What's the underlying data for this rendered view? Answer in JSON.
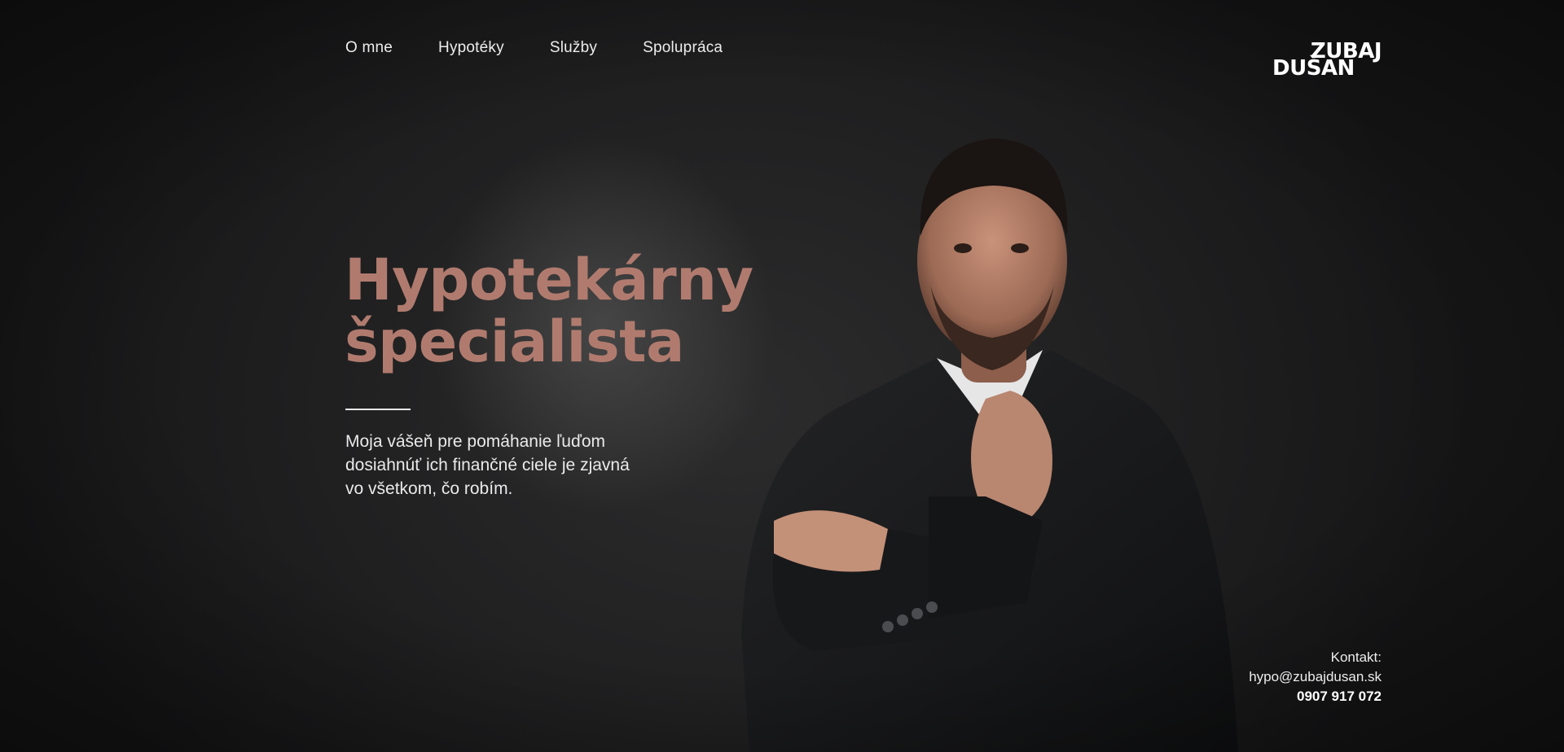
{
  "nav": {
    "items": [
      "O mne",
      "Hypotéky",
      "Služby",
      "Spolupráca"
    ]
  },
  "logo": {
    "line1": "ZUBAJ",
    "line2": "DUŠAN"
  },
  "hero": {
    "title_line1": "Hypotekárny",
    "title_line2": "špecialista",
    "text_line1": "Moja vášeň pre pomáhanie ľuďom",
    "text_line2": "dosiahnúť ich finančné ciele je zjavná",
    "text_line3": "vo všetkom, čo robím."
  },
  "contact": {
    "label": "Kontakt:",
    "email": "hypo@zubajdusan.sk",
    "phone": "0907 917 072"
  },
  "colors": {
    "accent": "#b07b6e",
    "background": "#1e1e1f"
  }
}
